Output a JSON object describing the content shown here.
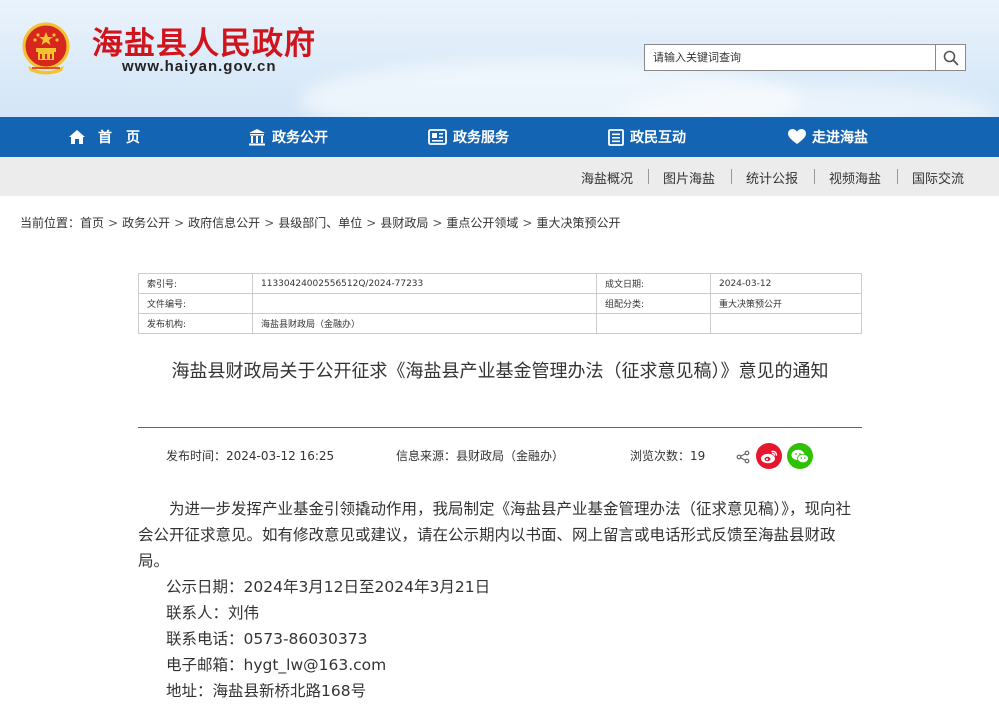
{
  "header": {
    "site_title": "海盐县人民政府",
    "site_url": "www.haiyan.gov.cn",
    "search_placeholder": "请输入关键词查询"
  },
  "nav": [
    {
      "label": "首　页",
      "icon": "home-icon"
    },
    {
      "label": "政务公开",
      "icon": "building-icon"
    },
    {
      "label": "政务服务",
      "icon": "card-icon"
    },
    {
      "label": "政民互动",
      "icon": "list-icon"
    },
    {
      "label": "走进海盐",
      "icon": "heart-icon"
    }
  ],
  "subnav": [
    "海盐概况",
    "图片海盐",
    "统计公报",
    "视频海盐",
    "国际交流"
  ],
  "breadcrumb": {
    "prefix": "当前位置：",
    "items": [
      "首页",
      "政务公开",
      "政府信息公开",
      "县级部门、单位",
      "县财政局",
      "重点公开领域",
      "重大决策预公开"
    ]
  },
  "info": {
    "index_key": "索引号:",
    "index_val": "11330424002556512Q/2024-77233",
    "date_key": "成文日期:",
    "date_val": "2024-03-12",
    "docno_key": "文件编号:",
    "docno_val": "",
    "category_key": "组配分类:",
    "category_val": "重大决策预公开",
    "publisher_key": "发布机构:",
    "publisher_val": "海盐县财政局（金融办）"
  },
  "article": {
    "title": "海盐县财政局关于公开征求《海盐县产业基金管理办法（征求意见稿）》意见的通知",
    "publish_time": "发布时间：2024-03-12 16:25",
    "source": "信息来源：县财政局（金融办）",
    "views": "浏览次数：19",
    "paragraph": "为进一步发挥产业基金引领撬动作用，我局制定《海盐县产业基金管理办法（征求意见稿）》，现向社会公开征求意见。如有修改意见或建议，请在公示期内以书面、网上留言或电话形式反馈至海盐县财政局。",
    "lines": [
      "公示日期：2024年3月12日至2024年3月21日",
      "联系人：刘伟",
      "联系电话：0573-86030373",
      "电子邮箱：hygt_lw@163.com",
      "地址：海盐县新桥北路168号"
    ]
  },
  "colors": {
    "brand_red": "#d0141c",
    "nav_blue": "#1464b4",
    "weibo_red": "#e6162d",
    "wechat_green": "#2dc100"
  }
}
